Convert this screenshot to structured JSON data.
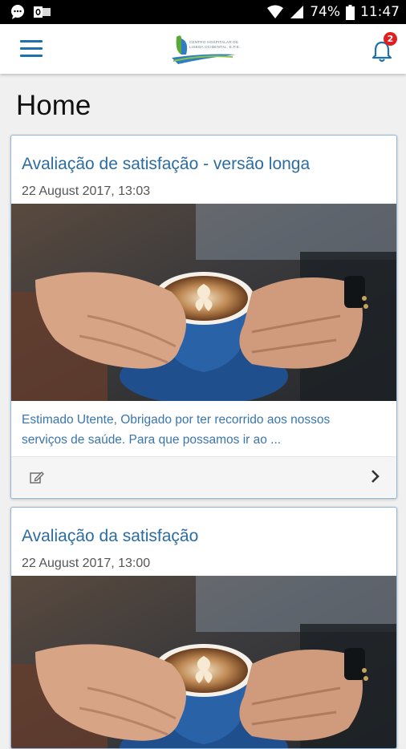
{
  "status_bar": {
    "battery": "74%",
    "time": "11:47",
    "icons": [
      "chat-bubble-icon",
      "outlook-icon",
      "wifi-icon",
      "signal-icon",
      "battery-icon"
    ]
  },
  "app_bar": {
    "menu_icon": "hamburger-menu-icon",
    "logo_text": [
      "CENTRO HOSPITALAR DE",
      "LISBOA OCIDENTAL, E.P.E."
    ],
    "notification_icon": "bell-icon",
    "notification_count": "2"
  },
  "page": {
    "title": "Home"
  },
  "cards": [
    {
      "title": "Avaliação de satisfação - versão longa",
      "date": "22 August 2017, 13:03",
      "excerpt_line1": "Estimado Utente, Obrigado por ter recorrido aos nossos",
      "excerpt_line2": "serviços de saúde. Para que possamos ir ao ...",
      "image": "coffee-cup-hands-photo"
    },
    {
      "title": "Avaliação da satisfação",
      "date": "22 August 2017, 13:00",
      "image": "coffee-cup-hands-photo"
    }
  ],
  "colors": {
    "accent": "#1f70ad",
    "title_blue": "#2b6ca3",
    "badge": "#e02020",
    "card_border": "#8fb7dc"
  }
}
